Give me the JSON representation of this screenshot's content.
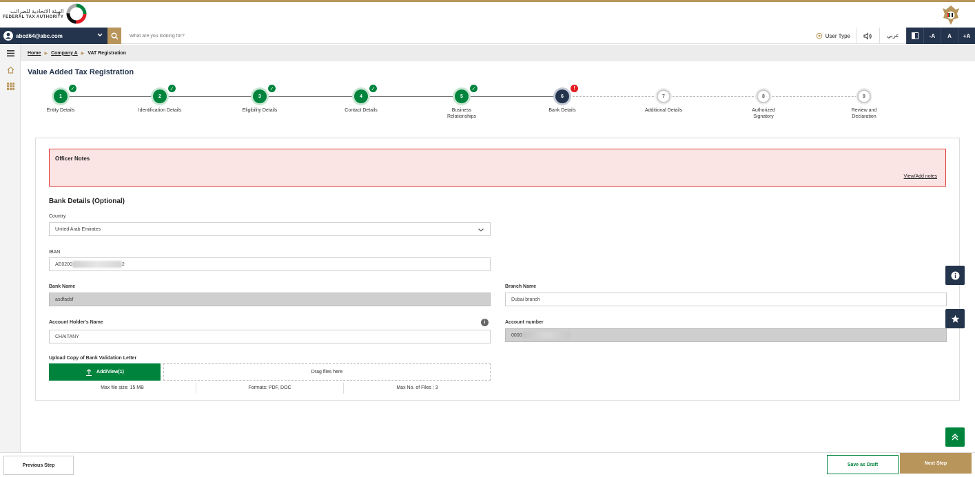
{
  "header": {
    "logo_ar": "الهيئة الاتحادية للضرائب",
    "logo_en": "FEDERAL TAX AUTHORITY"
  },
  "navbar": {
    "user_email": "abcd64@abc.com",
    "search_placeholder": "What are you looking for?",
    "user_type_label": "User Type",
    "language_label": "عربي",
    "font_decrease": "-A",
    "font_default": "A",
    "font_increase": "+A"
  },
  "breadcrumb": {
    "home": "Home",
    "company": "Company A",
    "current": "VAT Registration"
  },
  "page_title": "Value Added Tax Registration",
  "steps": [
    {
      "number": "1",
      "label": "Entity Details",
      "state": "done"
    },
    {
      "number": "2",
      "label": "Identification Details",
      "state": "done"
    },
    {
      "number": "3",
      "label": "Eligibility Details",
      "state": "done"
    },
    {
      "number": "4",
      "label": "Contact Details",
      "state": "done"
    },
    {
      "number": "5",
      "label": "Business Relationships",
      "state": "done"
    },
    {
      "number": "6",
      "label": "Bank Details",
      "state": "active"
    },
    {
      "number": "7",
      "label": "Additional Details",
      "state": "pending"
    },
    {
      "number": "8",
      "label": "Authorized Signatory",
      "state": "pending"
    },
    {
      "number": "9",
      "label": "Review and Declaration",
      "state": "pending"
    }
  ],
  "officer_notes": {
    "title": "Officer Notes",
    "link": "View/Add notes"
  },
  "form": {
    "section_title": "Bank Details (Optional)",
    "country_label": "Country",
    "country_value": "United Arab Emirates",
    "iban_label": "IBAN",
    "iban_prefix": "AE0200",
    "iban_suffix": "2",
    "bank_name_label": "Bank Name",
    "bank_name_value": "asdfadsf",
    "branch_name_label": "Branch Name",
    "branch_name_value": "Dubai branch",
    "holder_label": "Account Holder's Name",
    "holder_value": "CHAITANY",
    "account_label": "Account number",
    "account_prefix": "0000"
  },
  "upload": {
    "label": "Upload Copy of Bank Validation Letter",
    "button": "Add/View(1)",
    "drop": "Drag files here",
    "max_size": "Max file size: 15 MB",
    "formats": "Formats: PDF, DOC",
    "max_files": "Max No. of Files : 3"
  },
  "footer": {
    "previous": "Previous Step",
    "draft": "Save as Draft",
    "next": "Next Step"
  },
  "colors": {
    "navy": "#24344d",
    "gold": "#b8955a",
    "green": "#00843d",
    "error": "#e31b23"
  }
}
